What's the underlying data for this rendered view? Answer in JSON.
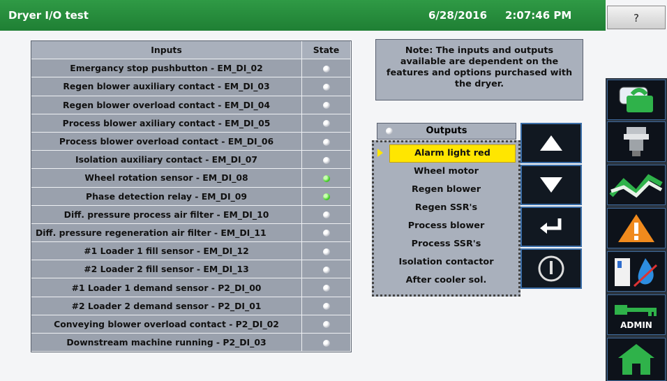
{
  "header": {
    "title": "Dryer I/O test",
    "date": "6/28/2016",
    "time": "2:07:46 PM",
    "help_label": "?"
  },
  "inputs": {
    "col_inputs": "Inputs",
    "col_state": "State",
    "rows": [
      {
        "name": "Emergancy stop pushbutton - EM_DI_02",
        "state": "off"
      },
      {
        "name": "Regen blower auxiliary contact - EM_DI_03",
        "state": "off"
      },
      {
        "name": "Regen blower overload contact - EM_DI_04",
        "state": "off"
      },
      {
        "name": "Process blower axiliary contact - EM_DI_05",
        "state": "off"
      },
      {
        "name": "Process blower overload contact - EM_DI_06",
        "state": "off"
      },
      {
        "name": "Isolation auxiliary contact - EM_DI_07",
        "state": "off"
      },
      {
        "name": "Wheel rotation sensor - EM_DI_08",
        "state": "on"
      },
      {
        "name": "Phase detection relay - EM_DI_09",
        "state": "on"
      },
      {
        "name": "Diff. pressure process air filter - EM_DI_10",
        "state": "off"
      },
      {
        "name": "Diff. pressure regeneration air filter - EM_DI_11",
        "state": "off"
      },
      {
        "name": "#1 Loader 1 fill sensor - EM_DI_12",
        "state": "off"
      },
      {
        "name": "#2 Loader 2 fill sensor - EM_DI_13",
        "state": "off"
      },
      {
        "name": "#1 Loader 1 demand sensor - P2_DI_00",
        "state": "off"
      },
      {
        "name": "#2 Loader 2 demand sensor - P2_DI_01",
        "state": "off"
      },
      {
        "name": "Conveying blower overload contact - P2_DI_02",
        "state": "off"
      },
      {
        "name": "Downstream machine running - P2_DI_03",
        "state": "off"
      }
    ]
  },
  "note": "Note: The inputs and outputs available are dependent on the features and options purchased with the dryer.",
  "outputs": {
    "header": "Outputs",
    "items": [
      "Alarm light red",
      "Wheel motor",
      "Regen blower",
      "Regen SSR's",
      "Process blower",
      "Process SSR's",
      "Isolation contactor",
      "After cooler sol."
    ],
    "selected": "Alarm light red"
  },
  "sidebar": {
    "admin_label": "ADMIN"
  },
  "colors": {
    "titlebar": "#1f7f34",
    "selected": "#ffe600",
    "led_on": "#4ad12e",
    "panel": "#a9b0bc"
  }
}
